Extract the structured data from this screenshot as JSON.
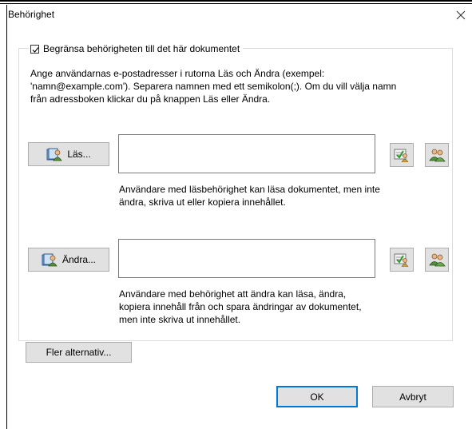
{
  "dialog": {
    "title": "Behörighet"
  },
  "restrict": {
    "checkbox_label": "Begränsa behörigheten till det här dokumentet",
    "checked": true
  },
  "description": {
    "line1": "Ange användarnas e-postadresser i rutorna Läs och Ändra (exempel:",
    "line2": "'namn@example.com'). Separera namnen med ett semikolon(;). Om du vill välja namn",
    "line3": "från adressboken klickar du på knappen Läs eller Ändra."
  },
  "read": {
    "button_label": "Läs...",
    "value": "",
    "help_line1": "Användare med läsbehörighet kan läsa dokumentet, men inte",
    "help_line2": "ändra, skriva ut eller kopiera innehållet."
  },
  "change": {
    "button_label": "Ändra...",
    "value": "",
    "help_line1": "Användare med behörighet att ändra kan läsa, ändra,",
    "help_line2": "kopiera innehåll från och spara ändringar av dokumentet,",
    "help_line3": "men inte skriva ut innehållet."
  },
  "buttons": {
    "more_options": "Fler alternativ...",
    "ok": "OK",
    "cancel": "Avbryt"
  },
  "icons": {
    "address_book": "address-book-icon",
    "check_names": "check-names-icon",
    "user_lookup": "users-icon",
    "close": "close-icon"
  }
}
